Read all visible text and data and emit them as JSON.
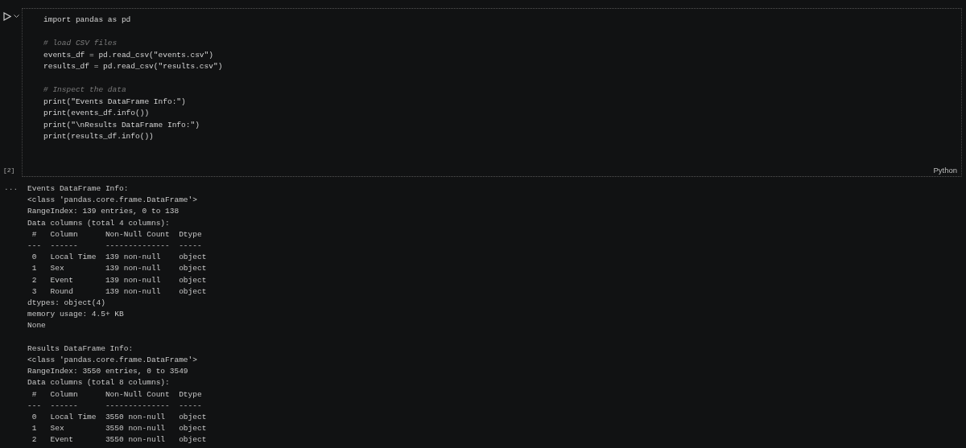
{
  "cell": {
    "execution_count": "[2]",
    "language": "Python",
    "code_blocks": [
      {
        "lines": [
          {
            "kind": "code",
            "text": "import pandas as pd"
          }
        ]
      },
      {
        "lines": [
          {
            "kind": "comment",
            "text": "# load CSV files"
          },
          {
            "kind": "code",
            "text": "events_df = pd.read_csv(\"events.csv\")"
          },
          {
            "kind": "code",
            "text": "results_df = pd.read_csv(\"results.csv\")"
          }
        ]
      },
      {
        "lines": [
          {
            "kind": "comment",
            "text": "# Inspect the data"
          },
          {
            "kind": "code",
            "text": "print(\"Events DataFrame Info:\")"
          },
          {
            "kind": "code",
            "text": "print(events_df.info())"
          },
          {
            "kind": "code",
            "text": "print(\"\\nResults DataFrame Info:\")"
          },
          {
            "kind": "code",
            "text": "print(results_df.info())"
          }
        ]
      }
    ]
  },
  "output": {
    "marker": "...",
    "blocks": [
      {
        "lines": [
          "Events DataFrame Info:",
          "<class 'pandas.core.frame.DataFrame'>",
          "RangeIndex: 139 entries, 0 to 138",
          "Data columns (total 4 columns):",
          " #   Column      Non-Null Count  Dtype ",
          "---  ------      --------------  ----- ",
          " 0   Local Time  139 non-null    object",
          " 1   Sex         139 non-null    object",
          " 2   Event       139 non-null    object",
          " 3   Round       139 non-null    object",
          "dtypes: object(4)",
          "memory usage: 4.5+ KB",
          "None"
        ]
      },
      {
        "lines": [
          "Results DataFrame Info:",
          "<class 'pandas.core.frame.DataFrame'>",
          "RangeIndex: 3550 entries, 0 to 3549",
          "Data columns (total 8 columns):",
          " #   Column      Non-Null Count  Dtype ",
          "---  ------      --------------  ----- ",
          " 0   Local Time  3550 non-null   object",
          " 1   Sex         3550 non-null   object",
          " 2   Event       3550 non-null   object"
        ]
      }
    ]
  }
}
